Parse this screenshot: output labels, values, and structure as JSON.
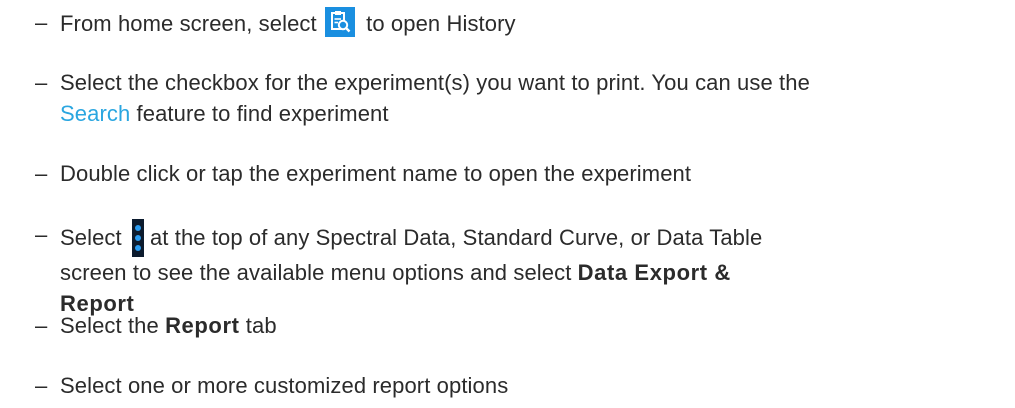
{
  "dash": "–",
  "steps": [
    {
      "before": "From home screen, select",
      "icon": "history-clipboard-search-icon",
      "after": "to open History"
    },
    {
      "line1": "Select the checkbox for the experiment(s) you want to print. You can use the",
      "link": "Search",
      "after_link": "feature to find experiment"
    },
    {
      "text": "Double click or tap the experiment name to open the experiment"
    },
    {
      "before": "Select",
      "icon": "vertical-dots-menu-icon",
      "after": "at the top of any Spectral Data, Standard Curve, or Data Table",
      "line2": "screen to see the available menu options and select",
      "bold": "Data Export & Report"
    },
    {
      "before": "Select the",
      "bold": "Report",
      "after": "tab"
    },
    {
      "text": "Select one or more customized report options"
    }
  ],
  "colors": {
    "text": "#2b2b2b",
    "link": "#2aa6e0",
    "icon_blue": "#1a8fe0",
    "menu_icon_bg": "#0c1b2e"
  }
}
